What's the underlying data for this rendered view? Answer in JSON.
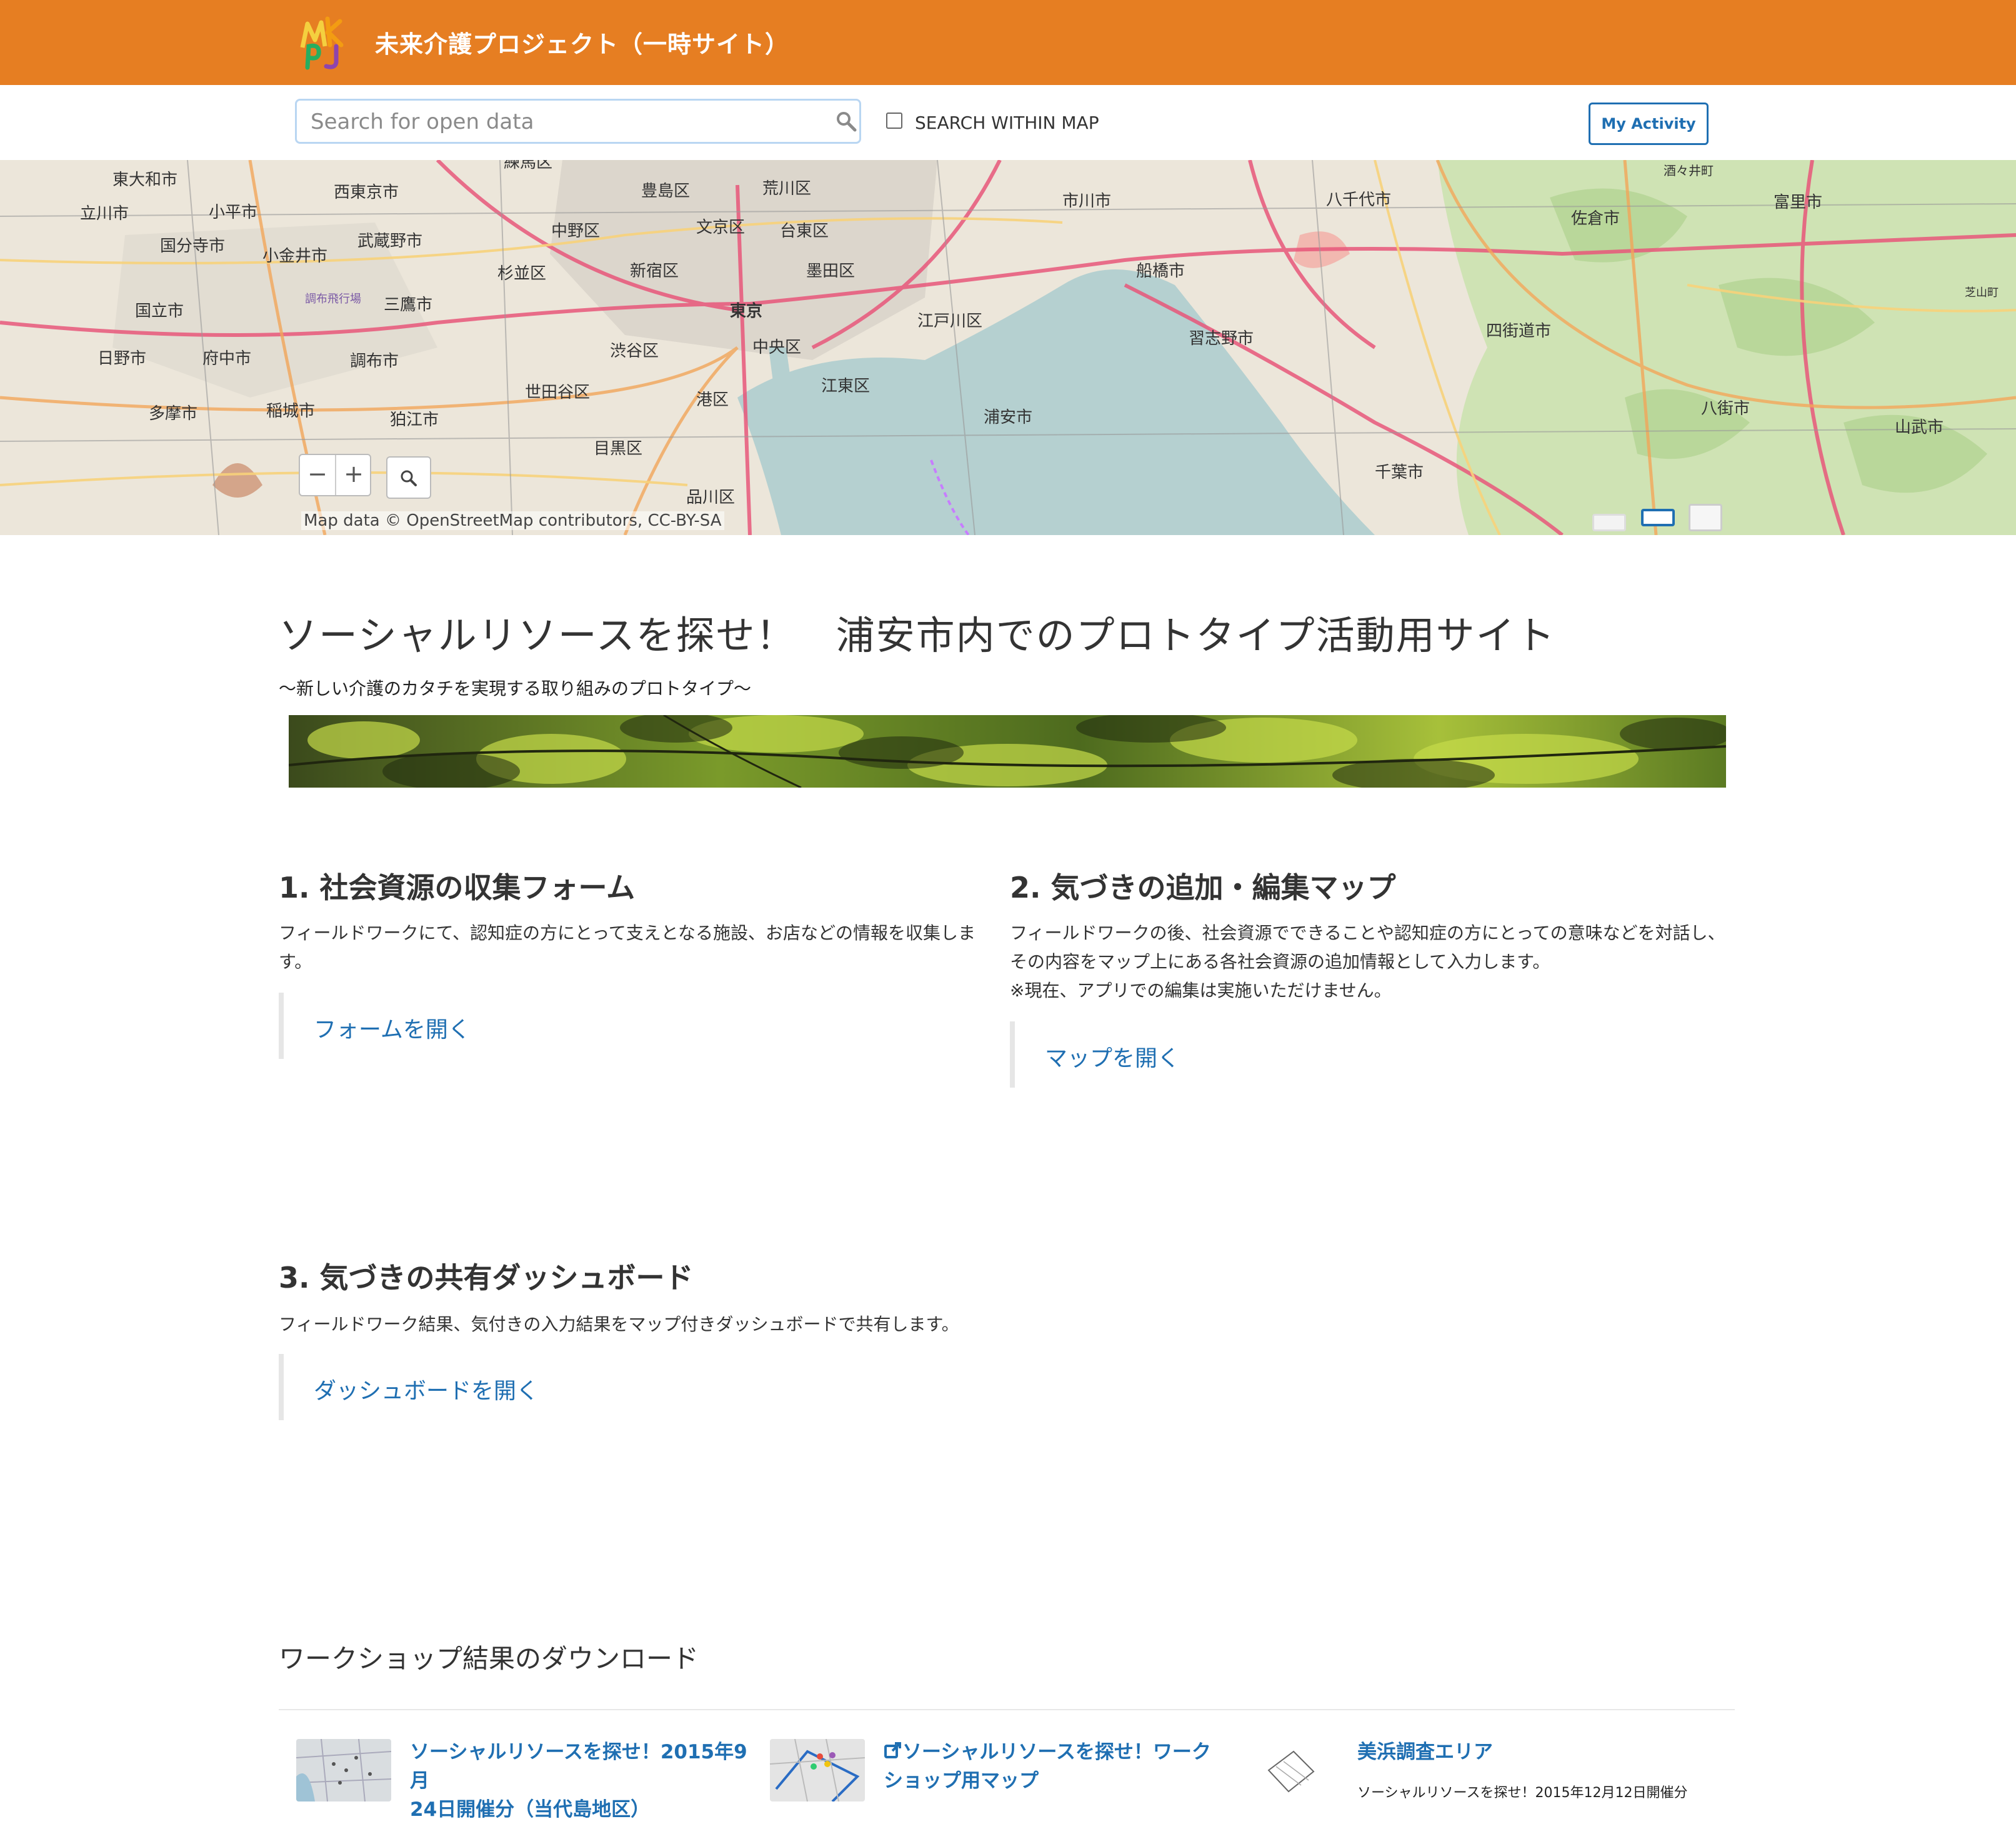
{
  "header": {
    "site_title": "未来介護プロジェクト（一時サイト）",
    "logo_icon": "mkpj-logo-icon",
    "bar_color": "#e67e22"
  },
  "search": {
    "placeholder": "Search for open data",
    "within_map_label": "SEARCH WITHIN MAP",
    "within_map_checked": false,
    "my_activity_label": "My Activity"
  },
  "map": {
    "attribution": "Map data © OpenStreetMap contributors, CC-BY-SA",
    "zoom_out_label": "−",
    "zoom_in_label": "+",
    "labels": [
      "東大和市",
      "立川市",
      "小平市",
      "国分寺市",
      "小金井市",
      "西東京市",
      "武蔵野市",
      "練馬区",
      "豊島区",
      "荒川区",
      "中野区",
      "文京区",
      "台東区",
      "杉並区",
      "新宿区",
      "墨田区",
      "三鷹市",
      "国立市",
      "調布飛行場",
      "日野市",
      "府中市",
      "調布市",
      "渋谷区",
      "東京",
      "中央区",
      "江戸川区",
      "市川市",
      "船橋市",
      "八千代市",
      "習志野市",
      "佐倉市",
      "四街道市",
      "富里市",
      "八街市",
      "山武市",
      "酒々井町",
      "芝山町",
      "狛江市",
      "世田谷区",
      "稲城市",
      "多摩市",
      "目黒区",
      "港区",
      "江東区",
      "浦安市",
      "品川区",
      "千葉市"
    ]
  },
  "main": {
    "title": "ソーシャルリソースを探せ！　浦安市内でのプロトタイプ活動用サイト",
    "subtitle": "〜新しい介護のカタチを実現する取り組みのプロトタイプ〜"
  },
  "sections": [
    {
      "title": "1. 社会資源の収集フォーム",
      "desc_line1": "フィールドワークにて、認知症の方にとって支えとなる施設、お店などの情報を収集しま",
      "desc_line2": "す。",
      "link": "フォームを開く"
    },
    {
      "title": "2. 気づきの追加・編集マップ",
      "desc_line1": "フィールドワークの後、社会資源でできることや認知症の方にとっての意味などを対話し、",
      "desc_line2": "その内容をマップ上にある各社会資源の追加情報として入力します。",
      "desc_line3": "※現在、アプリでの編集は実施いただけません。",
      "link": "マップを開く"
    },
    {
      "title": "3. 気づきの共有ダッシュボード",
      "desc_line1": "フィールドワーク結果、気付きの入力結果をマップ付きダッシュボードで共有します。",
      "link": "ダッシュボードを開く"
    }
  ],
  "downloads": {
    "title": "ワークショップ結果のダウンロード",
    "items": [
      {
        "line1": "ソーシャルリソースを探せ！2015年9月",
        "line2": "24日開催分（当代島地区）"
      },
      {
        "line1": "ソーシャルリソースを探せ！ワーク",
        "line2": "ショップ用マップ",
        "icon": "external-link-icon"
      },
      {
        "line1": "美浜調査エリア",
        "sub": "ソーシャルリソースを探せ！2015年12月12日開催分"
      }
    ]
  },
  "colors": {
    "link": "#1f6fb2",
    "accent": "#e67e22"
  }
}
